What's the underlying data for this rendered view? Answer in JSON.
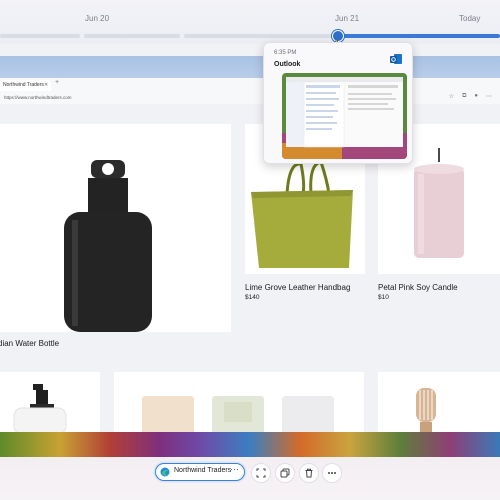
{
  "timeline": {
    "dates": [
      "Jun 20",
      "Jun 21",
      "Today"
    ]
  },
  "browser": {
    "tab_title": "Northwind Traders",
    "address": "https://www.northwindtraders.com"
  },
  "flyout": {
    "time": "6:35 PM",
    "app": "Outlook",
    "icon": "outlook-icon"
  },
  "products": [
    {
      "name": "Obsidian Water Bottle",
      "visible_name": "dian  Water Bottle",
      "price": ""
    },
    {
      "name": "Lime Grove Leather Handbag",
      "price": "$140"
    },
    {
      "name": "Petal Pink Soy Candle",
      "price": "$10"
    }
  ],
  "swatch_colors": [
    "#2d2d2d",
    "#d8d6cf",
    "#9fbcd6"
  ],
  "taskbar": {
    "app_label": "Northwind Traders",
    "more_label": "···",
    "actions": [
      "screenshot-icon",
      "copy-icon",
      "delete-icon",
      "more-icon"
    ]
  },
  "colors": {
    "accent": "#3b7bd6"
  }
}
